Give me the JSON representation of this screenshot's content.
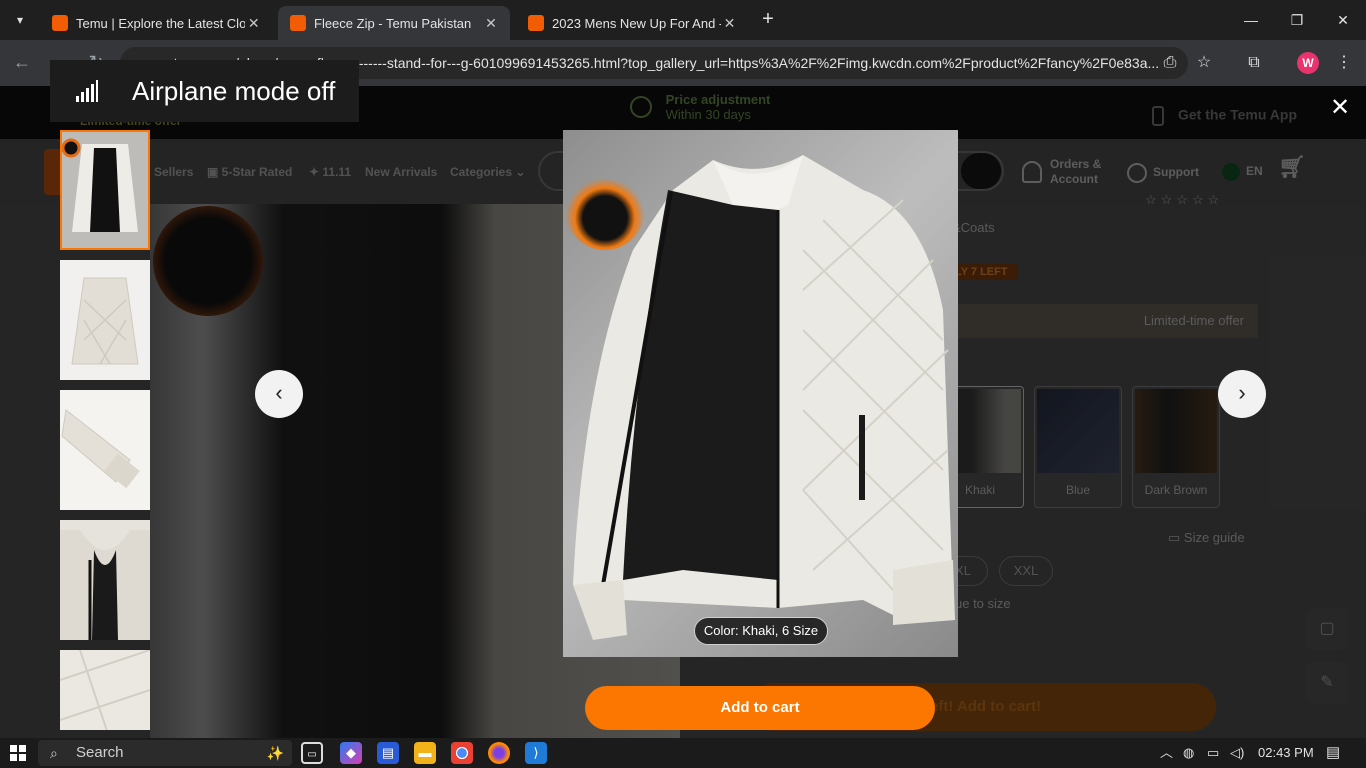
{
  "browser": {
    "tabs": [
      {
        "title": "Temu | Explore the Latest Clothi",
        "active": false
      },
      {
        "title": "Fleece Zip - Temu Pakistan",
        "active": true
      },
      {
        "title": "2023 Mens New Up For And - .",
        "active": false
      }
    ],
    "url": "...temu.com/pk-en/mens-fleece-------stand--for---g-601099691453265.html?top_gallery_url=https%3A%2F%2Fimg.kwcdn.com%2Fproduct%2Ffancy%2F0e83a...",
    "profile_initial": "W"
  },
  "toast": {
    "text": "Airplane mode off",
    "icon": "signal-bars-icon"
  },
  "page": {
    "promo": {
      "limited_time": "Limited-time offer",
      "price_adjustment_title": "Price adjustment",
      "price_adjustment_sub": "Within 30 days",
      "get_app": "Get the Temu App"
    },
    "nav": {
      "links": [
        "Sellers",
        "5-Star Rated",
        "11.11",
        "New Arrivals",
        "Categories"
      ],
      "orders_line1": "Orders &",
      "orders_line2": "Account",
      "support": "Support",
      "language": "EN"
    },
    "product": {
      "category_fragment": "&Coats",
      "stock_badge": "LY 7 LEFT",
      "offer": "Limited-time offer",
      "colors": [
        "Khaki",
        "Blue",
        "Dark Brown"
      ],
      "size_guide": "Size guide",
      "sizes": [
        "XL",
        "XXL"
      ],
      "fit_fragment": "ue to size",
      "cart_fragment": "eft! Add to cart!"
    }
  },
  "gallery": {
    "caption": "Color: Khaki, 6 Size",
    "add_to_cart": "Add to cart",
    "thumbnail_count": 5,
    "selected_thumbnail": 1
  },
  "taskbar": {
    "search_placeholder": "Search",
    "time": "02:43 PM"
  },
  "colors": {
    "accent": "#fb7701",
    "avatar": "#e8336d",
    "temu_favicon": "#f25c05"
  }
}
